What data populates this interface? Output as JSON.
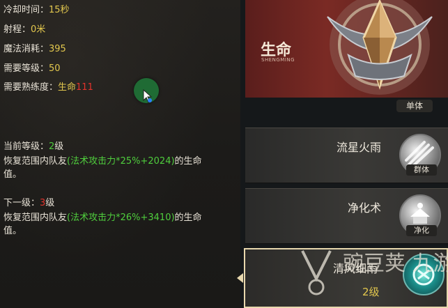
{
  "skill_info": {
    "cooldown_label": "冷却时间：",
    "cooldown_value": "15秒",
    "range_label": "射程：",
    "range_value": "0米",
    "mana_label": "魔法消耗：",
    "mana_value": "395",
    "level_req_label": "需要等级：",
    "level_req_value": "50",
    "proficiency_label": "需要熟练度：",
    "proficiency_type": "生命",
    "proficiency_value": "111"
  },
  "current_level": {
    "label": "当前等级：",
    "level": "2",
    "unit": "级",
    "desc_prefix": "恢复范围内队友",
    "formula": "(法术攻击力*25%+2024)",
    "desc_suffix": "的生命",
    "desc_end": "值。"
  },
  "next_level": {
    "label": "下一级：",
    "level": "3",
    "unit": "级",
    "desc_prefix": "恢复范围内队友",
    "formula": "(法术攻击力*26%+3410)",
    "desc_suffix": "的生命",
    "desc_end": "值。"
  },
  "featured_skill": {
    "name": "生命",
    "pinyin": "SHENGMING",
    "target_tag": "单体"
  },
  "skills": [
    {
      "name": "流星火雨",
      "tag": "群体",
      "icon": "meteor-rain-icon"
    },
    {
      "name": "净化术",
      "tag": "净化",
      "icon": "purify-icon"
    }
  ],
  "selected_skill": {
    "name": "清风细雨",
    "level": "2级",
    "icon": "cyan-orb-icon"
  },
  "watermark_text": "豌豆荚 九游",
  "colors": {
    "yellow": "#e3c84e",
    "red": "#e2332c",
    "green": "#4fce3d",
    "featured_bg": "#6b2520",
    "selected_border": "#e8d8ae"
  }
}
